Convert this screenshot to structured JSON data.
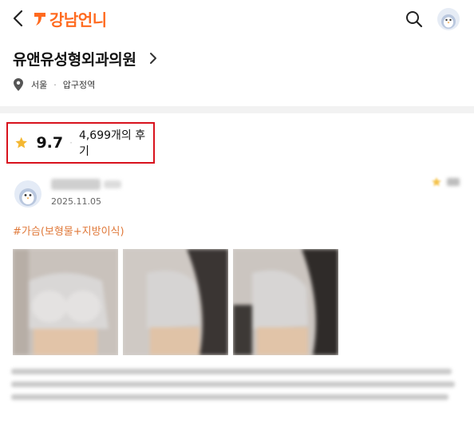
{
  "header": {
    "back_icon": "chevron-left-icon",
    "logo_text": "강남언니",
    "brand_color": "#ff6a1f",
    "search_icon": "search-icon"
  },
  "hospital": {
    "name": "유앤유성형외과의원",
    "city": "서울",
    "area": "압구정역"
  },
  "rating": {
    "score": "9.7",
    "reviews_label": "4,699개의 후기",
    "highlight_color": "#d8121d"
  },
  "review": {
    "date": "2025.11.05",
    "tag": "#가슴(보형물+지방이식)"
  }
}
